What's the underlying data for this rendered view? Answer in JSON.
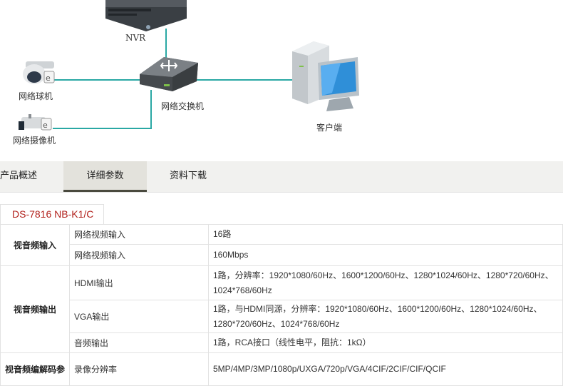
{
  "diagram": {
    "nvr_label": "NVR",
    "switch_label": "网络交换机",
    "dome_label": "网络球机",
    "bullet_label": "网络摄像机",
    "client_label": "客户端"
  },
  "tabs": [
    {
      "label": "产品概述"
    },
    {
      "label": "详细参数"
    },
    {
      "label": "资料下载"
    }
  ],
  "model": "DS-7816 NB-K1/C",
  "groups": [
    {
      "name": "视音频输入",
      "rows": [
        {
          "param": "网络视频输入",
          "value": "16路"
        },
        {
          "param": "网络视频输入",
          "value": "160Mbps"
        }
      ]
    },
    {
      "name": "视音频输出",
      "rows": [
        {
          "param": "HDMI输出",
          "value": "1路，分辨率：1920*1080/60Hz、1600*1200/60Hz、1280*1024/60Hz、1280*720/60Hz、1024*768/60Hz"
        },
        {
          "param": "VGA输出",
          "value": "1路，与HDMI同源，分辨率：1920*1080/60Hz、1600*1200/60Hz、1280*1024/60Hz、1280*720/60Hz、1024*768/60Hz"
        },
        {
          "param": "音频输出",
          "value": "1路，RCA接口（线性电平，阻抗：1kΩ）"
        }
      ]
    },
    {
      "name": "视音频编解码参",
      "rows": [
        {
          "param": "录像分辨率",
          "value": "5MP/4MP/3MP/1080p/UXGA/720p/VGA/4CIF/2CIF/CIF/QCIF"
        }
      ]
    }
  ]
}
